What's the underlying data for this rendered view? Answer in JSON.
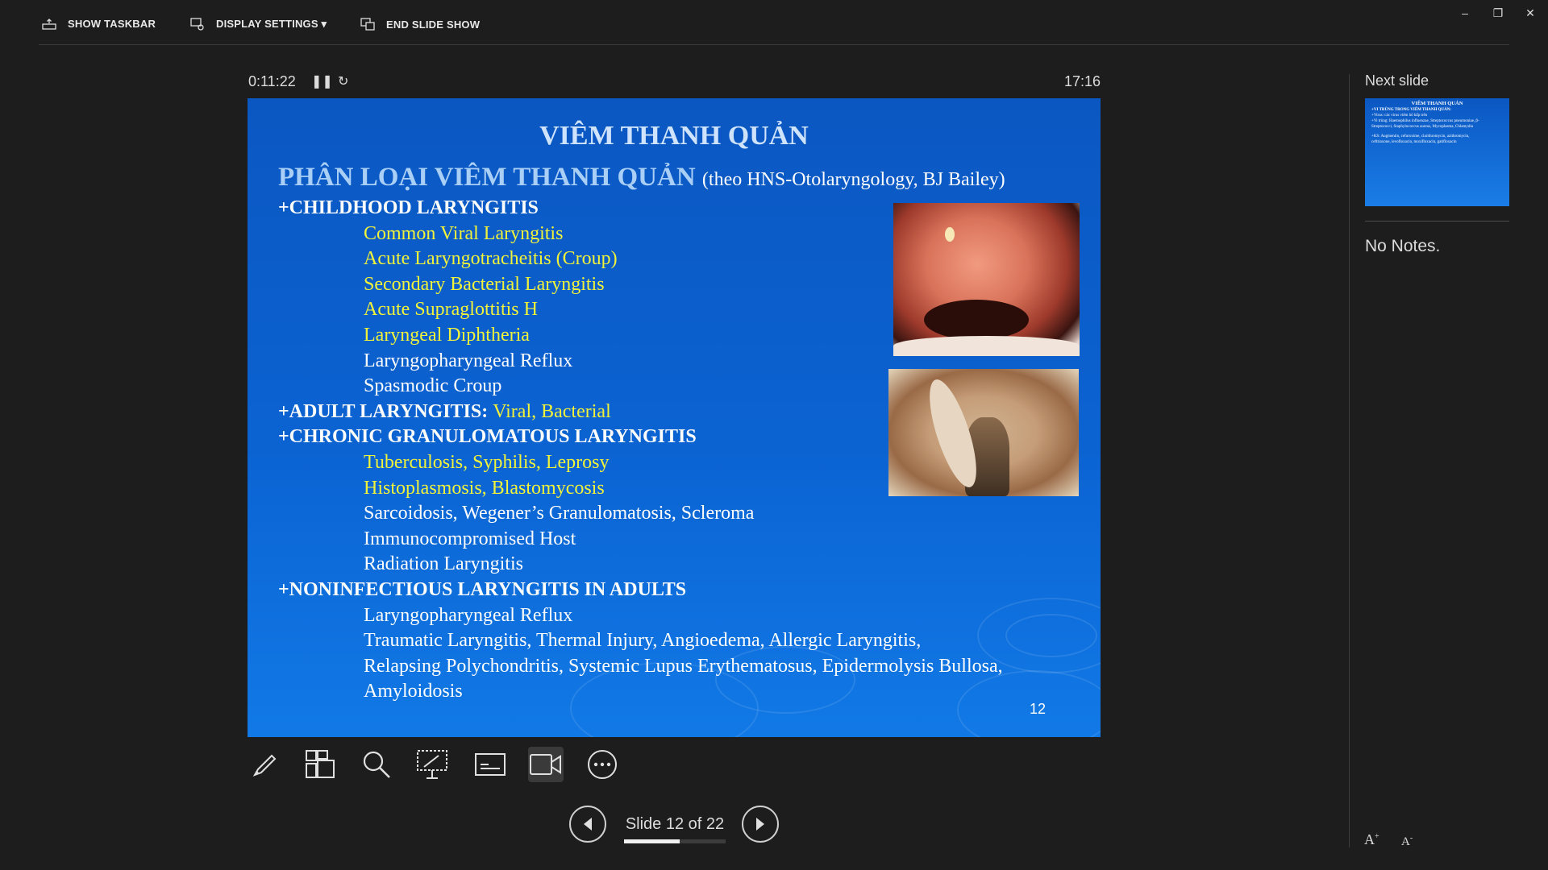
{
  "topbar": {
    "show_taskbar": "SHOW TASKBAR",
    "display_settings": "DISPLAY SETTINGS ▾",
    "end_slide_show": "END SLIDE SHOW"
  },
  "presenter": {
    "elapsed": "0:11:22",
    "clock": "17:16"
  },
  "slide": {
    "title": "VIÊM THANH QUẢN",
    "subtitle": "PHÂN LOẠI VIÊM THANH QUẢN",
    "source": "(theo HNS-Otolaryngology, BJ Bailey)",
    "lines": [
      {
        "hdr": "+CHILDHOOD LARYNGITIS",
        "indent": false
      },
      {
        "text": "Common Viral Laryngitis",
        "color": "yel"
      },
      {
        "text": "Acute Laryngotracheitis (Croup)",
        "color": "yel"
      },
      {
        "text": "Secondary Bacterial Laryngitis",
        "color": "yel"
      },
      {
        "text": "Acute Supraglottitis H",
        "color": "yel"
      },
      {
        "text": "Laryngeal Diphtheria",
        "color": "yel"
      },
      {
        "text": "Laryngopharyngeal Reflux",
        "color": "wht"
      },
      {
        "text": "Spasmodic Croup",
        "color": "wht"
      },
      {
        "hdr": "+ADULT LARYNGITIS: ",
        "tail": "Viral, Bacterial"
      },
      {
        "hdr": "+CHRONIC GRANULOMATOUS LARYNGITIS"
      },
      {
        "text": "Tuberculosis, Syphilis, Leprosy",
        "color": "yel"
      },
      {
        "text": "Histoplasmosis, Blastomycosis",
        "color": "yel"
      },
      {
        "text": "Sarcoidosis, Wegener’s Granulomatosis, Scleroma",
        "color": "wht"
      },
      {
        "text": "Immunocompromised Host",
        "color": "wht"
      },
      {
        "text": "Radiation Laryngitis",
        "color": "wht"
      },
      {
        "hdr": "+NONINFECTIOUS LARYNGITIS IN ADULTS"
      },
      {
        "text": "Laryngopharyngeal Reflux",
        "color": "wht"
      },
      {
        "text": "Traumatic Laryngitis, Thermal Injury, Angioedema, Allergic Laryngitis,",
        "color": "wht"
      },
      {
        "text": "Relapsing Polychondritis, Systemic Lupus Erythematosus, Epidermolysis Bullosa,",
        "color": "wht"
      },
      {
        "text": "Amyloidosis",
        "color": "wht"
      }
    ],
    "page_number": "12"
  },
  "navigation": {
    "counter": "Slide 12 of 22",
    "progress": 0.545
  },
  "sidebar": {
    "next_label": "Next slide",
    "notes": "No Notes."
  },
  "next_slide_thumb": {
    "title": "VIÊM THANH QUẢN",
    "line1": "+VI TRÙNG TRONG VIÊM THANH QUẢN:",
    "line2": "+Virus: các virus viêm hô hấp trên",
    "line3": "+Vi trùng: Haemophilus influenzae, Streptococcus pneumoniae, β-",
    "line4": "Streptococci, Staphylococcus aureus, Mycoplasma, Chlamydia",
    "line5": "+KS: Augmentin, cefuroxime, clarithromycin, azithromycin,",
    "line6": "ceftriaxone, levofloxacin, moxifloxacin, gatifloxacin"
  },
  "toolbar_icons": [
    "pen-icon",
    "all-slides-icon",
    "zoom-icon",
    "laser-pointer-icon",
    "subtitles-icon",
    "camera-icon",
    "more-options-icon"
  ]
}
